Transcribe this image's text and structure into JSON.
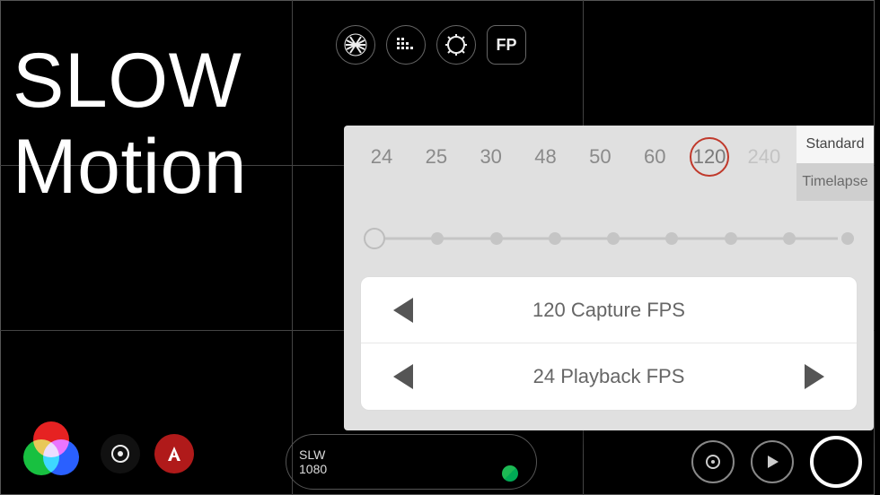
{
  "title": {
    "line1": "SLOW",
    "line2": "Motion"
  },
  "top_icons": {
    "zebra": "zebra-icon",
    "histogram": "histogram-icon",
    "gear": "gear-icon",
    "fp": "FP"
  },
  "mode": {
    "line1": "SLW",
    "line2": "1080"
  },
  "fps_panel": {
    "tabs": {
      "standard": "Standard",
      "timelapse": "Timelapse",
      "active": "standard"
    },
    "options": [
      {
        "value": "24",
        "disabled": false,
        "selected": false
      },
      {
        "value": "25",
        "disabled": false,
        "selected": false
      },
      {
        "value": "30",
        "disabled": false,
        "selected": false
      },
      {
        "value": "48",
        "disabled": false,
        "selected": false
      },
      {
        "value": "50",
        "disabled": false,
        "selected": false
      },
      {
        "value": "60",
        "disabled": false,
        "selected": false
      },
      {
        "value": "120",
        "disabled": false,
        "selected": true
      },
      {
        "value": "240",
        "disabled": true,
        "selected": false
      }
    ],
    "slider_stops": 9,
    "capture_label": "120 Capture FPS",
    "playback_label": "24 Playback FPS"
  }
}
